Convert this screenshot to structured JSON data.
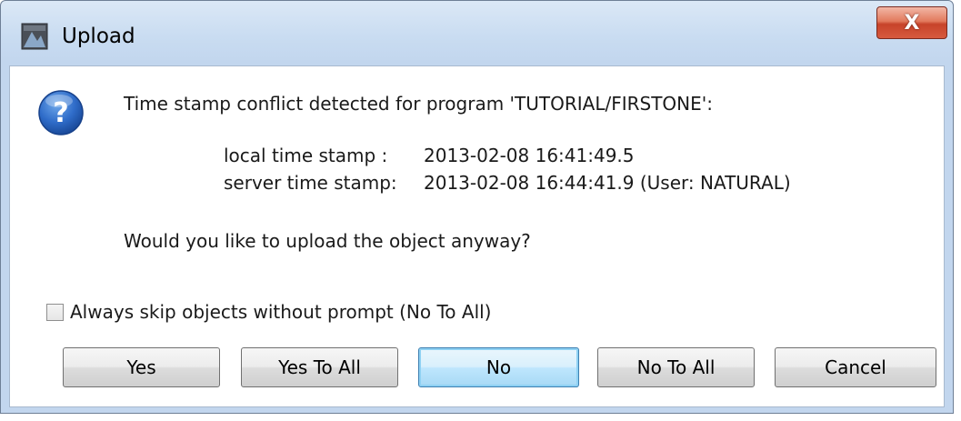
{
  "window": {
    "title": "Upload",
    "close_label": "X"
  },
  "dialog": {
    "message": "Time stamp conflict detected for program 'TUTORIAL/FIRSTONE':",
    "local_label": "local time stamp  :",
    "local_value": "2013-02-08 16:41:49.5",
    "server_label": "server time stamp:",
    "server_value": "2013-02-08 16:44:41.9 (User: NATURAL)",
    "question": "Would you like to upload the object anyway?",
    "checkbox_label": "Always skip objects without prompt (No To All)",
    "checkbox_checked": false
  },
  "buttons": {
    "yes": "Yes",
    "yes_to_all": "Yes To All",
    "no": "No",
    "no_to_all": "No To All",
    "cancel": "Cancel"
  },
  "colors": {
    "title_bar": "#c9dcf1",
    "close": "#c7432a",
    "default_button": "#bee6fd"
  },
  "icons": {
    "app": "upload-app-icon",
    "question": "question-icon",
    "close": "close-icon"
  }
}
